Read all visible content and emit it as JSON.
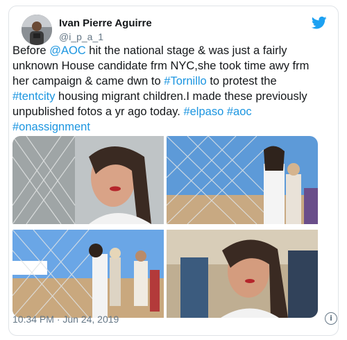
{
  "author": {
    "name": "Ivan Pierre Aguirre",
    "handle": "@i_p_a_1"
  },
  "tweet": {
    "segments": [
      {
        "text": "Before ",
        "link": false
      },
      {
        "text": "@AOC",
        "link": true
      },
      {
        "text": " hit the national stage & was just a fairly unknown House candidate frm NYC,she took time awy frm her campaign & came dwn to ",
        "link": false
      },
      {
        "text": "#Tornillo",
        "link": true
      },
      {
        "text": " to protest the ",
        "link": false
      },
      {
        "text": "#tentcity",
        "link": true
      },
      {
        "text": " housing migrant children.I made these previously unpublished fotos a yr ago today. ",
        "link": false
      },
      {
        "text": "#elpaso",
        "link": true
      },
      {
        "text": " ",
        "link": false
      },
      {
        "text": "#aoc",
        "link": true
      },
      {
        "text": " ",
        "link": false
      },
      {
        "text": "#onassignment",
        "link": true
      }
    ],
    "timestamp": "10:34 PM · Jun 24, 2019"
  },
  "icons": {
    "brand": "twitter-bird-icon",
    "info": "info-icon"
  },
  "colors": {
    "link": "#1b95e0",
    "brand": "#1da1f2",
    "secondary_text": "#657786"
  }
}
